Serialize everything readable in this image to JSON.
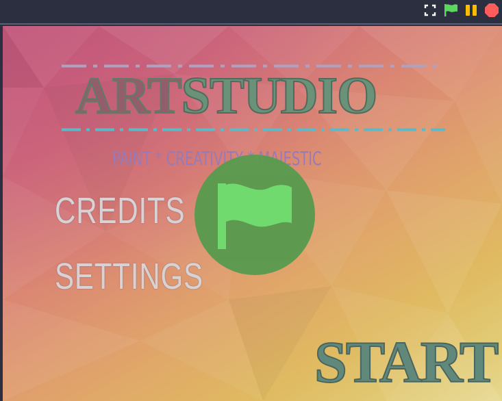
{
  "controls": {
    "fullscreen_icon": "fullscreen-icon",
    "flag_icon": "green-flag-icon",
    "pause_icon": "pause-icon",
    "stop_icon": "stop-icon",
    "flag_color": "#5cd65c",
    "pause_color": "#ffbf00",
    "stop_color": "#ff5c5c"
  },
  "stage": {
    "title_word1": "ART",
    "title_word2": "STUDIO",
    "tagline": "PAINT  *  CREATIVITY  *  MAJESTIC",
    "menu": {
      "credits": "CREDITS",
      "settings": "SETTINGS"
    },
    "start": "START",
    "overlay_button_icon": "green-flag-icon",
    "overlay_color": "#5b9a4f"
  }
}
